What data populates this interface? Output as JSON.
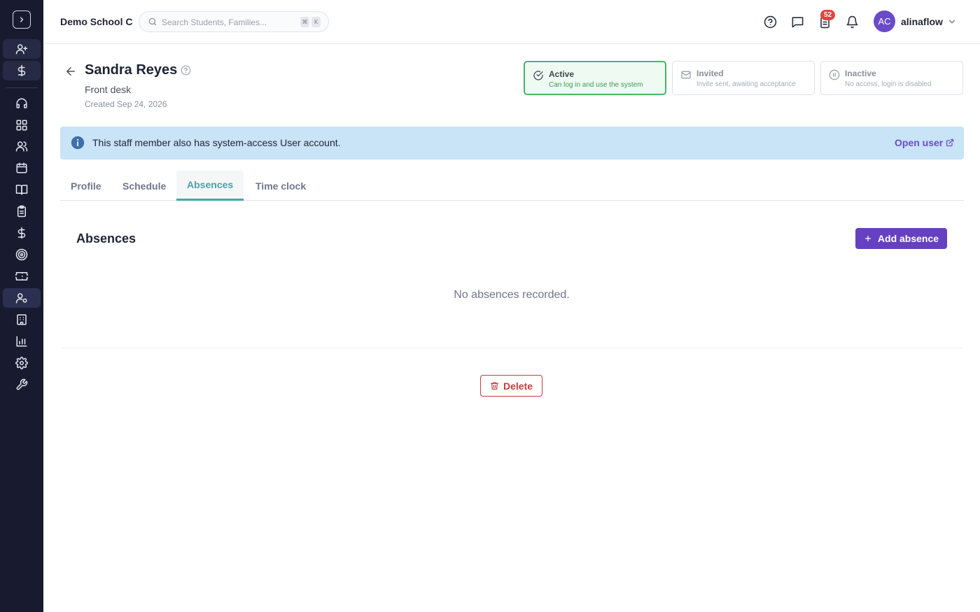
{
  "topbar": {
    "school_name": "Demo School C",
    "search_placeholder": "Search Students, Families...",
    "search_shortcut": [
      "⌘",
      "K"
    ],
    "notification_count": "52",
    "user": {
      "initials": "AC",
      "name": "alinaflow"
    }
  },
  "sidebar": {
    "icons": [
      "chevron-right-icon",
      "user-plus-icon",
      "dollar-icon",
      "headset-icon",
      "dashboard-icon",
      "users-icon",
      "calendar-icon",
      "book-icon",
      "clipboard-icon",
      "dollar-icon",
      "target-icon",
      "ticket-icon",
      "staff-settings-icon",
      "building-icon",
      "bar-chart-icon",
      "gear-icon",
      "wrench-icon"
    ],
    "active_item": "staff-settings-icon"
  },
  "header": {
    "name": "Sandra Reyes",
    "role": "Front desk",
    "created": "Created Sep 24, 2026"
  },
  "status_options": [
    {
      "title": "Active",
      "subtitle": "Can log in and use the system",
      "selected": true
    },
    {
      "title": "Invited",
      "subtitle": "Invite sent, awaiting acceptance",
      "selected": false
    },
    {
      "title": "Inactive",
      "subtitle": "No access, login is disabled",
      "selected": false
    }
  ],
  "banner": {
    "text": "This staff member also has system-access User account.",
    "link_label": "Open user"
  },
  "tabs": [
    {
      "label": "Profile",
      "active": false
    },
    {
      "label": "Schedule",
      "active": false
    },
    {
      "label": "Absences",
      "active": true
    },
    {
      "label": "Time clock",
      "active": false
    }
  ],
  "absences": {
    "title": "Absences",
    "add_label": "Add absence",
    "empty_text": "No absences recorded."
  },
  "actions": {
    "delete_label": "Delete"
  },
  "colors": {
    "sidebar_bg": "#181b30",
    "primary": "#6541c1",
    "active_tab": "#4ba3a6",
    "active_status": "#4cb36a",
    "banner_bg": "#c9e3f7",
    "danger": "#c93b3b",
    "badge": "#e0463f"
  }
}
